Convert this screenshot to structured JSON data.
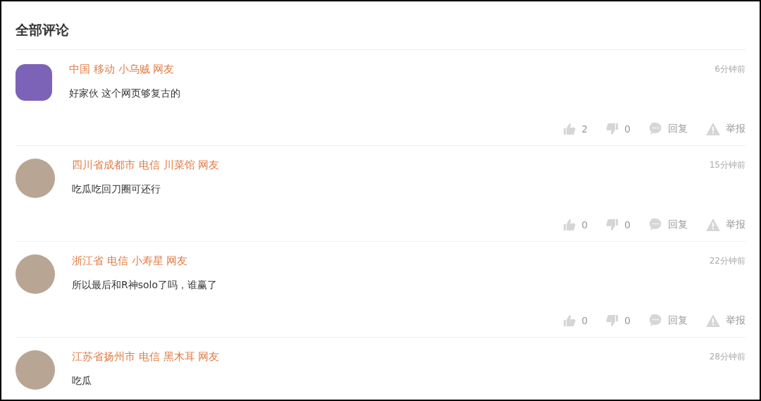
{
  "title": "全部评论",
  "comments": [
    {
      "avatar": {
        "kind": "cartoon"
      },
      "user": "中国 移动 小乌贼 网友",
      "time": "6分钟前",
      "text": "好家伙 这个网页够复古的",
      "actions": {
        "likes": "2",
        "dislikes": "0",
        "reply": "回复",
        "report": "举报"
      }
    },
    {
      "avatar": {
        "kind": "photo"
      },
      "user": "四川省成都市 电信 川菜馆 网友",
      "time": "15分钟前",
      "text": "吃瓜吃回刀圈可还行",
      "actions": {
        "likes": "0",
        "dislikes": "0",
        "reply": "回复",
        "report": "举报"
      }
    },
    {
      "avatar": {
        "kind": "photo"
      },
      "user": "浙江省 电信 小寿星 网友",
      "time": "22分钟前",
      "text": "所以最后和R神solo了吗，谁赢了",
      "actions": {
        "likes": "0",
        "dislikes": "0",
        "reply": "回复",
        "report": "举报"
      }
    },
    {
      "avatar": {
        "kind": "photo"
      },
      "user": "江苏省扬州市 电信 黑木耳 网友",
      "time": "28分钟前",
      "text": "吃瓜"
    }
  ]
}
